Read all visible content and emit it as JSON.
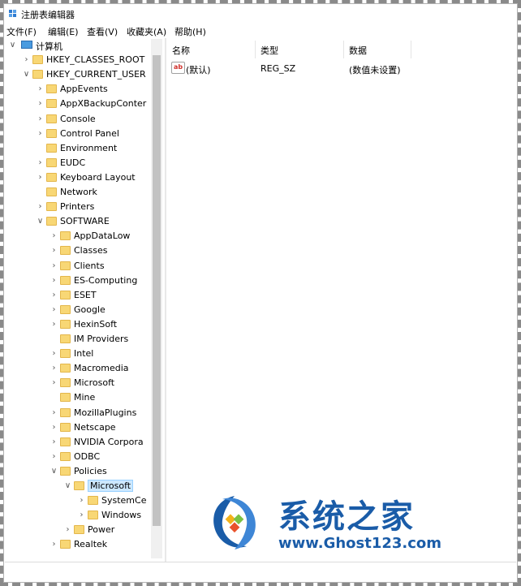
{
  "window": {
    "title": "注册表编辑器"
  },
  "menu": [
    "文件(F)",
    "编辑(E)",
    "查看(V)",
    "收藏夹(A)",
    "帮助(H)"
  ],
  "tree": [
    {
      "label": "计算机",
      "level": 0,
      "expander": "open",
      "icon": "computer-icon"
    },
    {
      "label": "HKEY_CLASSES_ROOT",
      "level": 1,
      "expander": "closed"
    },
    {
      "label": "HKEY_CURRENT_USER",
      "level": 1,
      "expander": "open"
    },
    {
      "label": "AppEvents",
      "level": 2,
      "expander": "closed"
    },
    {
      "label": "AppXBackupConter",
      "level": 2,
      "expander": "closed"
    },
    {
      "label": "Console",
      "level": 2,
      "expander": "closed"
    },
    {
      "label": "Control Panel",
      "level": 2,
      "expander": "closed"
    },
    {
      "label": "Environment",
      "level": 2,
      "expander": "none"
    },
    {
      "label": "EUDC",
      "level": 2,
      "expander": "closed"
    },
    {
      "label": "Keyboard Layout",
      "level": 2,
      "expander": "closed"
    },
    {
      "label": "Network",
      "level": 2,
      "expander": "none"
    },
    {
      "label": "Printers",
      "level": 2,
      "expander": "closed"
    },
    {
      "label": "SOFTWARE",
      "level": 2,
      "expander": "open"
    },
    {
      "label": "AppDataLow",
      "level": 3,
      "expander": "closed"
    },
    {
      "label": "Classes",
      "level": 3,
      "expander": "closed"
    },
    {
      "label": "Clients",
      "level": 3,
      "expander": "closed"
    },
    {
      "label": "ES-Computing",
      "level": 3,
      "expander": "closed"
    },
    {
      "label": "ESET",
      "level": 3,
      "expander": "closed"
    },
    {
      "label": "Google",
      "level": 3,
      "expander": "closed"
    },
    {
      "label": "HexinSoft",
      "level": 3,
      "expander": "closed"
    },
    {
      "label": "IM Providers",
      "level": 3,
      "expander": "none"
    },
    {
      "label": "Intel",
      "level": 3,
      "expander": "closed"
    },
    {
      "label": "Macromedia",
      "level": 3,
      "expander": "closed"
    },
    {
      "label": "Microsoft",
      "level": 3,
      "expander": "closed"
    },
    {
      "label": "Mine",
      "level": 3,
      "expander": "none"
    },
    {
      "label": "MozillaPlugins",
      "level": 3,
      "expander": "closed"
    },
    {
      "label": "Netscape",
      "level": 3,
      "expander": "closed"
    },
    {
      "label": "NVIDIA Corpora",
      "level": 3,
      "expander": "closed"
    },
    {
      "label": "ODBC",
      "level": 3,
      "expander": "closed"
    },
    {
      "label": "Policies",
      "level": 3,
      "expander": "open"
    },
    {
      "label": "Microsoft",
      "level": 4,
      "expander": "open",
      "selected": true
    },
    {
      "label": "SystemCe",
      "level": 5,
      "expander": "closed"
    },
    {
      "label": "Windows",
      "level": 5,
      "expander": "closed"
    },
    {
      "label": "Power",
      "level": 4,
      "expander": "closed"
    },
    {
      "label": "Realtek",
      "level": 3,
      "expander": "closed"
    }
  ],
  "list": {
    "columns": [
      "名称",
      "类型",
      "数据"
    ],
    "rows": [
      {
        "icon": "string-value-icon",
        "icon_text": "ab",
        "name": "(默认)",
        "type": "REG_SZ",
        "data": "(数值未设置)"
      }
    ]
  },
  "watermark": {
    "brand": "系统之家",
    "url": "www.Ghost123.com"
  }
}
